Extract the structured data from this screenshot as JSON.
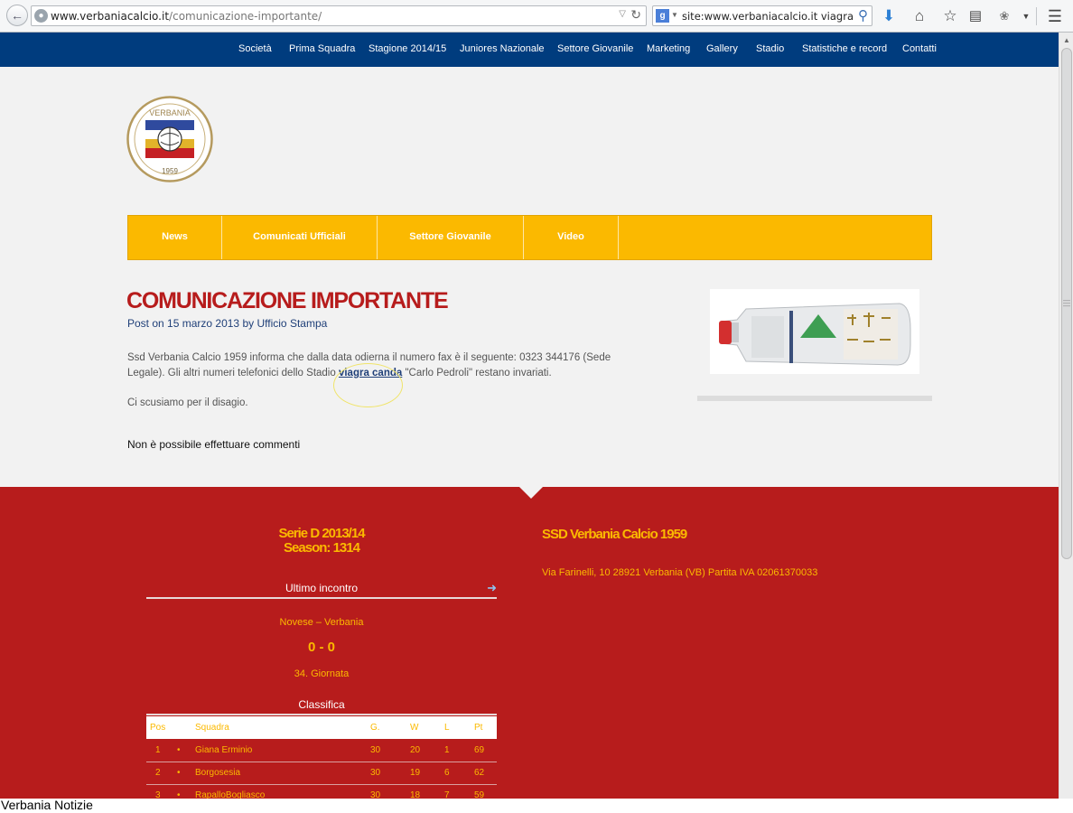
{
  "browser": {
    "url_domain": "www.verbaniacalcio.it",
    "url_path": "/comunicazione-importante/",
    "search_engine_letter": "g",
    "search_query": "site:www.verbaniacalcio.it viagra"
  },
  "site_nav": [
    "Società",
    "Prima Squadra",
    "Stagione 2014/15",
    "Juniores Nazionale",
    "Settore Giovanile",
    "Marketing",
    "Gallery",
    "Stadio",
    "Statistiche e record",
    "Contatti"
  ],
  "logo": {
    "top_text": "VERBANIA",
    "year": "1959"
  },
  "category_nav": [
    "News",
    "Comunicati Ufficiali",
    "Settore Giovanile",
    "Video"
  ],
  "post": {
    "title": "COMUNICAZIONE IMPORTANTE",
    "meta_prefix": "Post on",
    "date": "15 marzo 2013",
    "meta_by": "by",
    "author": "Ufficio Stampa",
    "p1_before_link": "Ssd Verbania Calcio 1959 informa che dalla data odierna il numero fax è il seguente: 0323 344176 (Sede Legale). Gli altri numeri telefonici dello Stadio ",
    "p1_link": "viagra canda",
    "p1_after_link": " \"Carlo Pedroli\" restano invariati.",
    "p2": "Ci scusiamo per il disagio.",
    "comments_note": "Non è possibile effettuare commenti"
  },
  "footer": {
    "season_line1": "Serie D 2013/14",
    "season_line2": "Season: 1314",
    "last_match_heading": "Ultimo incontro",
    "match_teams": "Novese – Verbania",
    "match_score": "0 - 0",
    "match_round": "34. Giornata",
    "standings_heading": "Classifica",
    "standings_columns": [
      "Pos",
      "Squadra",
      "G.",
      "W",
      "L",
      "Pt"
    ],
    "standings_rows": [
      {
        "pos": "1",
        "bullet": "•",
        "team": "Giana Erminio",
        "g": "30",
        "w": "20",
        "l": "1",
        "pt": "69"
      },
      {
        "pos": "2",
        "bullet": "•",
        "team": "Borgosesia",
        "g": "30",
        "w": "19",
        "l": "6",
        "pt": "62"
      },
      {
        "pos": "3",
        "bullet": "•",
        "team": "RapalloBogliasco",
        "g": "30",
        "w": "18",
        "l": "7",
        "pt": "59"
      }
    ],
    "club_name": "SSD Verbania Calcio 1959",
    "club_address": "Via Farinelli, 10 28921 Verbania (VB) Partita IVA 02061370033"
  },
  "caption": "Verbania Notizie",
  "colors": {
    "nav_blue": "#003c7e",
    "accent_yellow": "#fbb900",
    "footer_red": "#b71c1c",
    "title_red": "#b71c1c",
    "link_blue": "#1f3f78"
  }
}
